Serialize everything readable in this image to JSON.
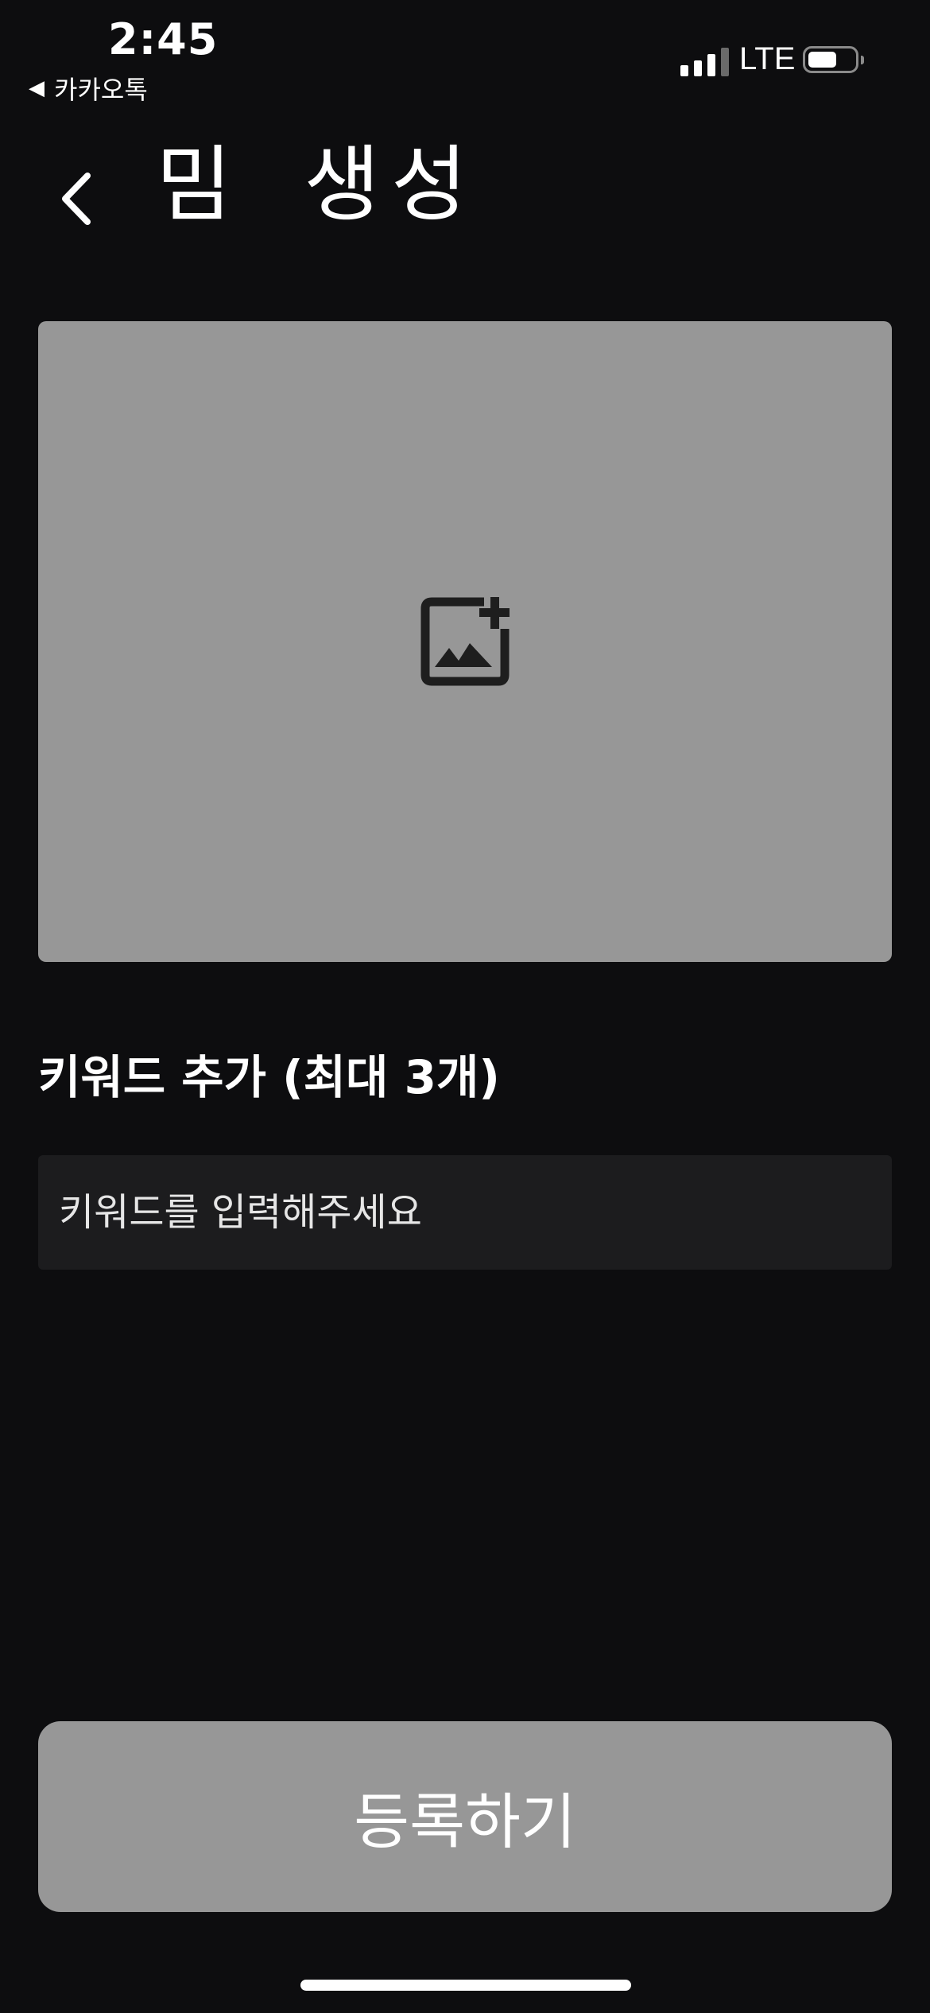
{
  "status_bar": {
    "time": "2:45",
    "back_app_label": "카카오톡",
    "back_app_glyph": "◀",
    "network": "LTE",
    "signal_bars": 4,
    "signal_bars_active": 3,
    "battery_level": 0.6
  },
  "header": {
    "back_icon": "chevron-left-icon",
    "title": "밈 생성"
  },
  "image_upload": {
    "icon": "add-photo-icon",
    "background_color": "#979797"
  },
  "keyword": {
    "heading": "키워드 추가 (최대 3개)",
    "input_placeholder": "키워드를 입력해주세요",
    "input_value": ""
  },
  "submit": {
    "label": "등록하기",
    "background_color": "#979797"
  },
  "colors": {
    "background": "#0d0d0f",
    "input_background": "#1c1c1e"
  }
}
